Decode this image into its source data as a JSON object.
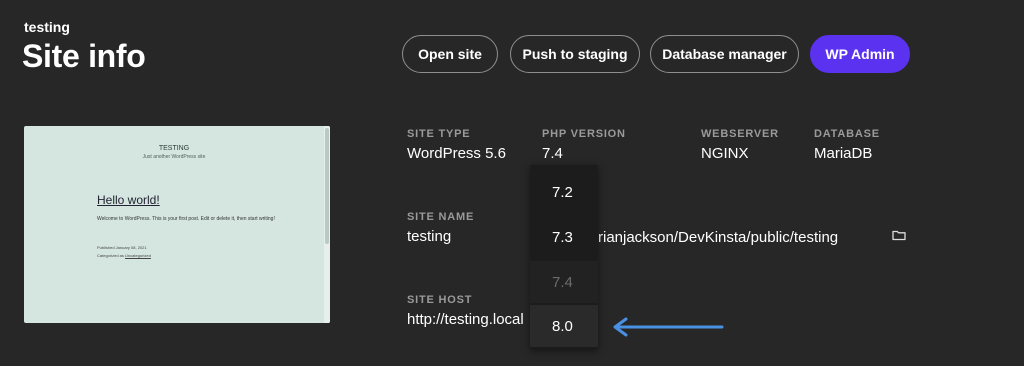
{
  "header": {
    "site_label": "testing",
    "title": "Site info"
  },
  "actions": {
    "open_site": "Open site",
    "push_to_staging": "Push to staging",
    "database_manager": "Database manager",
    "wp_admin": "WP Admin",
    "primary_color": "#5b32f0"
  },
  "thumbnail": {
    "site_title": "TESTING",
    "tagline": "Just another WordPress site",
    "post_title": "Hello world!",
    "post_body": "Welcome to WordPress. This is your first post. Edit or delete it, then start writing!",
    "published": "Published January 08, 2021",
    "categorized_prefix": "Categorized as",
    "category": "Uncategorized"
  },
  "info": {
    "site_type_label": "SITE TYPE",
    "site_type": "WordPress 5.6",
    "php_label": "PHP VERSION",
    "php_value": "7.4",
    "webserver_label": "WEBSERVER",
    "webserver": "NGINX",
    "database_label": "DATABASE",
    "database": "MariaDB",
    "site_name_label": "SITE NAME",
    "site_name": "testing",
    "path_partial": "rianjackson/DevKinsta/public/testing",
    "site_host_label": "SITE HOST",
    "site_host": "http://testing.local"
  },
  "php_dropdown": {
    "options": [
      "7.2",
      "7.3",
      "7.4",
      "8.0"
    ],
    "disabled": "7.4"
  },
  "icons": {
    "folder": "folder-icon",
    "arrow": "arrow-left-icon"
  },
  "arrow_color": "#4a90e2"
}
